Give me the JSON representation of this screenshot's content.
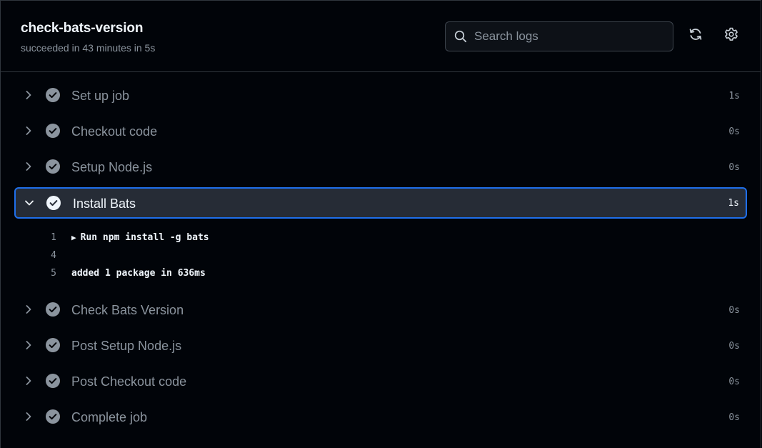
{
  "header": {
    "title": "check-bats-version",
    "subtitle": "succeeded in 43 minutes in 5s",
    "search_placeholder": "Search logs"
  },
  "icons": {
    "search": "search-icon",
    "refresh": "refresh-icon",
    "settings": "gear-icon",
    "collapsed": "chevron-right-icon",
    "expanded": "chevron-down-icon",
    "status": "check-circle-icon"
  },
  "colors": {
    "background": "#010409",
    "border": "#30363d",
    "accent": "#1f6feb",
    "muted_text": "#8b949e",
    "text": "#f0f6fc"
  },
  "steps": [
    {
      "label": "Set up job",
      "duration": "1s",
      "expanded": false
    },
    {
      "label": "Checkout code",
      "duration": "0s",
      "expanded": false
    },
    {
      "label": "Setup Node.js",
      "duration": "0s",
      "expanded": false
    },
    {
      "label": "Install Bats",
      "duration": "1s",
      "expanded": true
    },
    {
      "label": "Check Bats Version",
      "duration": "0s",
      "expanded": false
    },
    {
      "label": "Post Setup Node.js",
      "duration": "0s",
      "expanded": false
    },
    {
      "label": "Post Checkout code",
      "duration": "0s",
      "expanded": false
    },
    {
      "label": "Complete job",
      "duration": "0s",
      "expanded": false
    }
  ],
  "log": [
    {
      "line": "1",
      "text": "Run npm install -g bats",
      "group": true
    },
    {
      "line": "4",
      "text": "",
      "group": false
    },
    {
      "line": "5",
      "text": "added 1 package in 636ms",
      "group": false
    }
  ]
}
